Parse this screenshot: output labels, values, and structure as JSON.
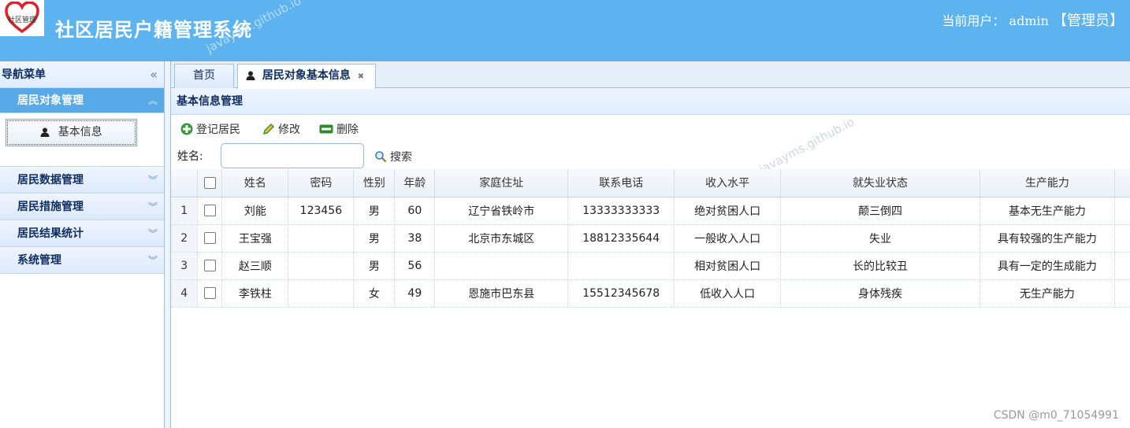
{
  "header": {
    "logo_text": "社区管理",
    "title": "社区居民户籍管理系统",
    "watermark": "javayms.github.io",
    "user_label": "当前用户：",
    "username": "admin",
    "role": "【管理员】"
  },
  "sidebar": {
    "title": "导航菜单",
    "groups": [
      {
        "label": "居民对象管理",
        "expanded": true,
        "items": [
          {
            "label": "基本信息"
          }
        ]
      },
      {
        "label": "居民数据管理",
        "expanded": false
      },
      {
        "label": "居民措施管理",
        "expanded": false
      },
      {
        "label": "居民结果统计",
        "expanded": false
      },
      {
        "label": "系统管理",
        "expanded": false
      }
    ]
  },
  "tabs": [
    {
      "label": "首页"
    },
    {
      "label": "居民对象基本信息",
      "active": true
    }
  ],
  "panel": {
    "title": "基本信息管理",
    "toolbar": {
      "add": "登记居民",
      "edit": "修改",
      "delete": "删除"
    },
    "search": {
      "label": "姓名:",
      "value": "",
      "button": "搜索"
    }
  },
  "table": {
    "columns": [
      "姓名",
      "密码",
      "性别",
      "年龄",
      "家庭住址",
      "联系电话",
      "收入水平",
      "就失业状态",
      "生产能力"
    ],
    "rows": [
      {
        "num": "1",
        "name": "刘能",
        "password": "123456",
        "gender": "男",
        "age": "60",
        "address": "辽宁省铁岭市",
        "phone": "13333333333",
        "income": "绝对贫困人口",
        "employment": "颠三倒四",
        "capacity": "基本无生产能力"
      },
      {
        "num": "2",
        "name": "王宝强",
        "password": "",
        "gender": "男",
        "age": "38",
        "address": "北京市东城区",
        "phone": "18812335644",
        "income": "一般收入人口",
        "employment": "失业",
        "capacity": "具有较强的生产能力"
      },
      {
        "num": "3",
        "name": "赵三顺",
        "password": "",
        "gender": "男",
        "age": "56",
        "address": "",
        "phone": "",
        "income": "相对贫困人口",
        "employment": "长的比较丑",
        "capacity": "具有一定的生成能力"
      },
      {
        "num": "4",
        "name": "李铁柱",
        "password": "",
        "gender": "女",
        "age": "49",
        "address": "恩施市巴东县",
        "phone": "15512345678",
        "income": "低收入人口",
        "employment": "身体残疾",
        "capacity": "无生产能力"
      }
    ]
  },
  "footer_watermark": "CSDN @m0_71054991",
  "colors": {
    "header": "#5cb3f0",
    "active_group": "#58a9e8",
    "add_icon": "#3a9a3a",
    "edit_icon": "#3f8f2f",
    "delete_icon": "#2e8b2e"
  }
}
